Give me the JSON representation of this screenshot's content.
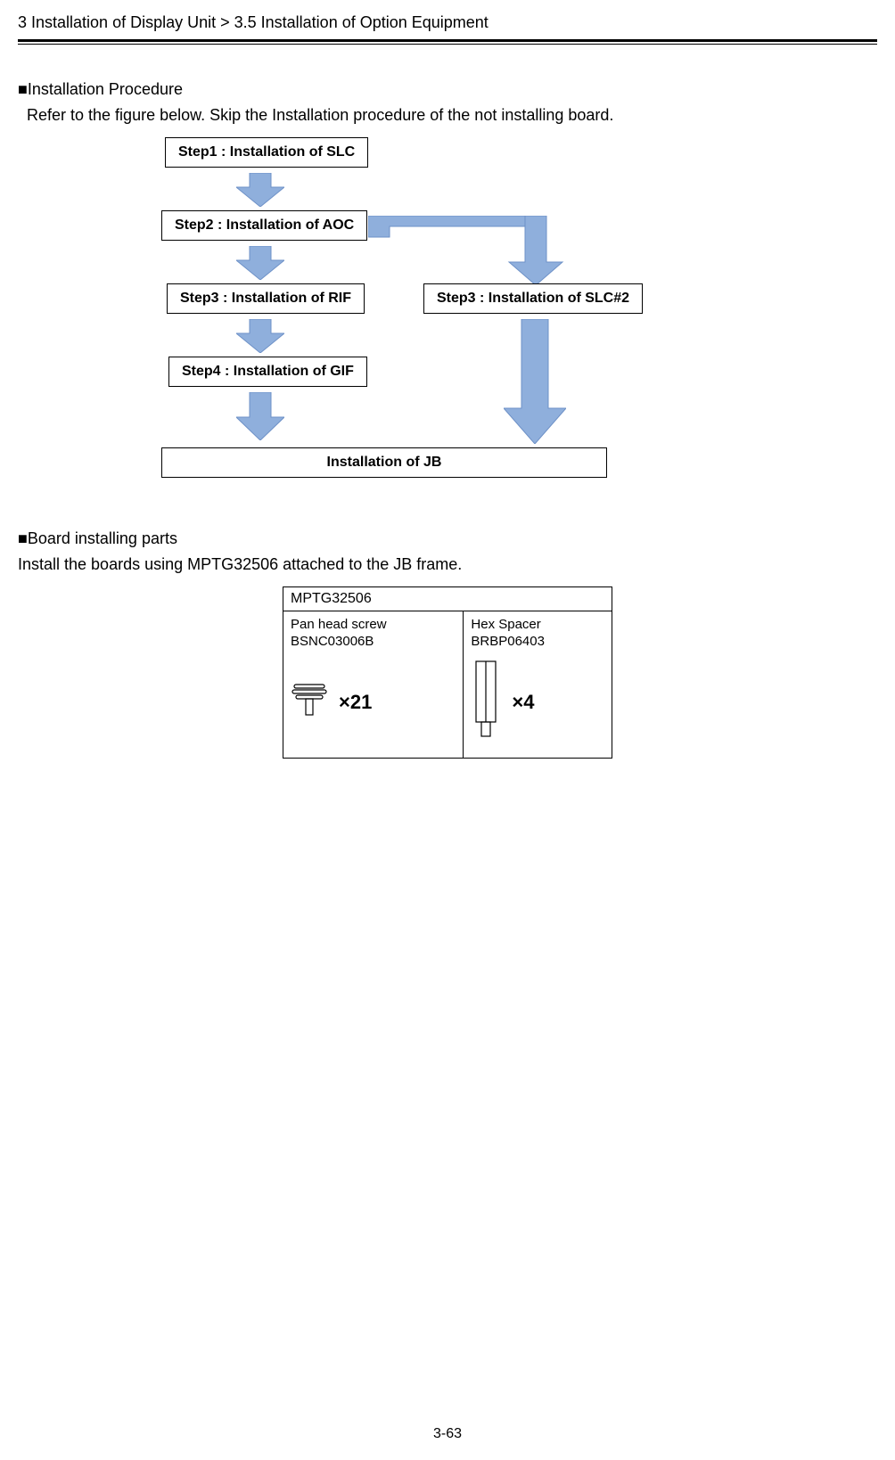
{
  "breadcrumb": "3 Installation of Display Unit > 3.5 Installation of Option Equipment",
  "section1": {
    "title": "■Installation Procedure",
    "desc": "Refer to the figure below. Skip the Installation procedure of the not installing board."
  },
  "flow": {
    "step1": "Step1 : Installation of SLC",
    "step2": "Step2 : Installation of AOC",
    "step3a": "Step3 : Installation of RIF",
    "step3b": "Step3 : Installation of SLC#2",
    "step4": "Step4 : Installation of GIF",
    "final": "Installation of JB"
  },
  "section2": {
    "title": "■Board installing parts",
    "desc": "Install the boards using MPTG32506 attached to the JB frame."
  },
  "parts": {
    "kit": "MPTG32506",
    "left_name": "Pan head screw",
    "left_code": "BSNC03006B",
    "left_qty": "×21",
    "right_name": "Hex Spacer",
    "right_code": "BRBP06403",
    "right_qty": "×4"
  },
  "page_number": "3-63"
}
